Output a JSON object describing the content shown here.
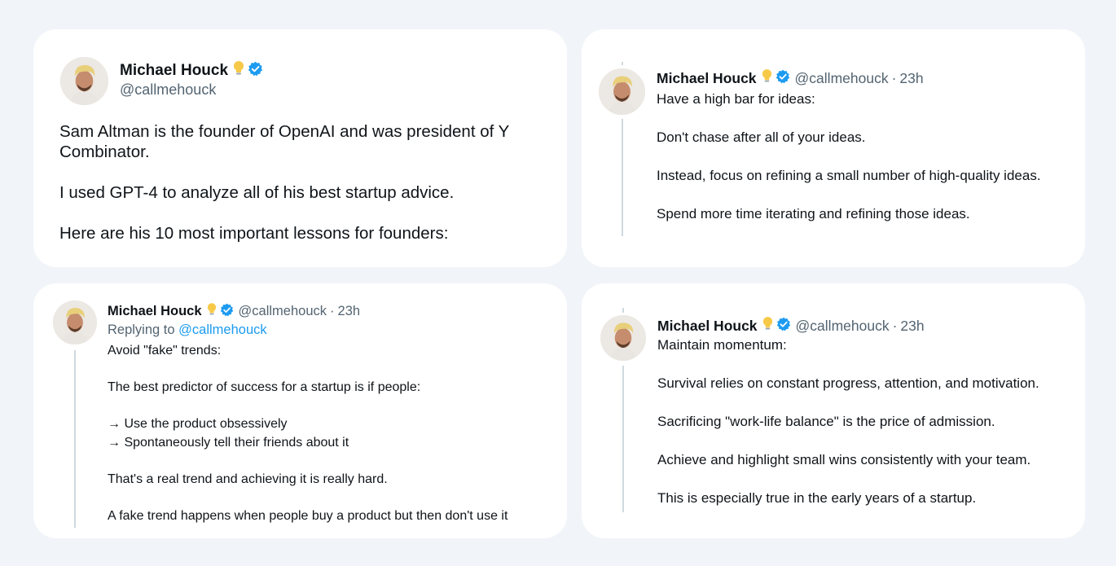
{
  "tweets": [
    {
      "name": "Michael Houck",
      "handle": "@callmehouck",
      "text": "Sam Altman is the founder of OpenAI and was president of Y Combinator.\n\nI used GPT-4 to analyze all of his best startup advice.\n\nHere are his 10 most important lessons for founders:"
    },
    {
      "name": "Michael Houck",
      "handle": "@callmehouck",
      "separator": "·",
      "time": "23h",
      "text": "Have a high bar for ideas:\n\nDon't chase after all of your ideas.\n\nInstead, focus on refining a small number of high-quality ideas.\n\nSpend more time iterating and refining those ideas."
    },
    {
      "name": "Michael Houck",
      "handle": "@callmehouck",
      "separator": "·",
      "time": "23h",
      "replying_to_prefix": "Replying to",
      "replying_to_handle": "@callmehouck",
      "text": "Avoid \"fake\" trends:\n\nThe best predictor of success for a startup is if people:\n\n→ Use the product obsessively\n→ Spontaneously tell their friends about it\n\nThat's a real trend and achieving it is really hard.\n\nA fake trend happens when people buy a product but then don't use it"
    },
    {
      "name": "Michael Houck",
      "handle": "@callmehouck",
      "separator": "·",
      "time": "23h",
      "text": "Maintain momentum:\n\nSurvival relies on constant progress, attention, and motivation.\n\nSacrificing \"work-life balance\" is the price of admission.\n\nAchieve and highlight small wins consistently with your team.\n\nThis is especially true in the early years of a startup."
    }
  ],
  "icons": {
    "bulb": "lightbulb-icon",
    "badge": "verified-badge-icon"
  },
  "colors": {
    "background": "#f1f4f8",
    "card": "#ffffff",
    "text": "#0f1419",
    "muted": "#536471",
    "accent": "#1d9bf0",
    "thread_line": "#cfd9de"
  }
}
